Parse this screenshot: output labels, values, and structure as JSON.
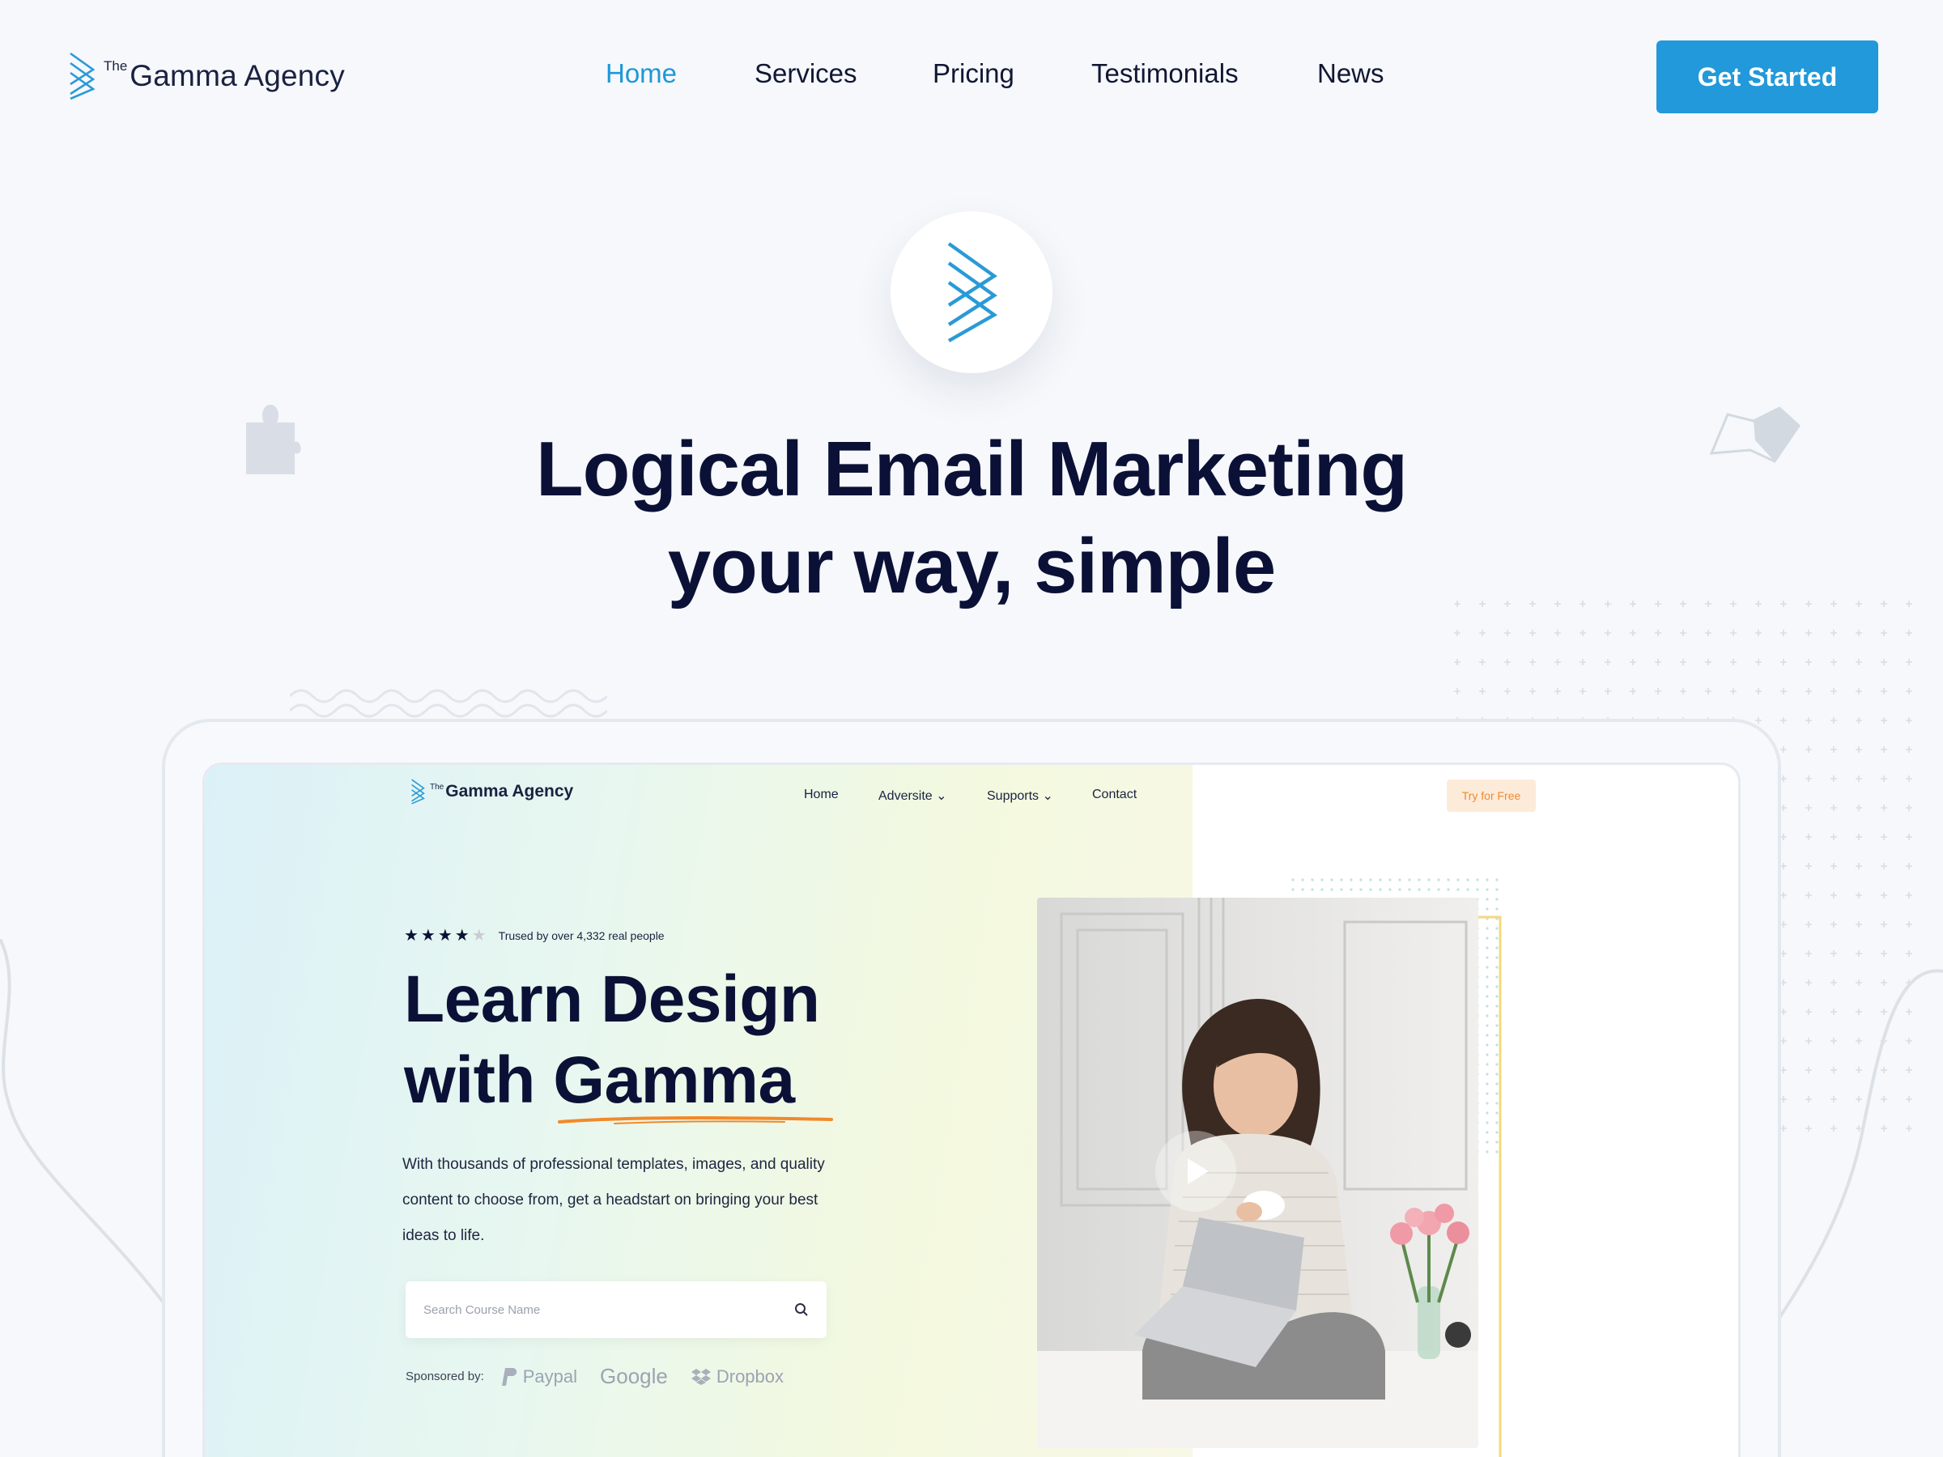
{
  "brand": {
    "prefix": "The",
    "name": "Gamma Agency"
  },
  "nav": {
    "items": [
      {
        "label": "Home",
        "active": true
      },
      {
        "label": "Services",
        "active": false
      },
      {
        "label": "Pricing",
        "active": false
      },
      {
        "label": "Testimonials",
        "active": false
      },
      {
        "label": "News",
        "active": false
      }
    ],
    "cta_label": "Get Started"
  },
  "hero": {
    "title_line1": "Logical Email Marketing",
    "title_line2": "your way, simple"
  },
  "mockup": {
    "brand": {
      "prefix": "The",
      "name": "Gamma Agency"
    },
    "nav": [
      "Home",
      "Adversite ⌄",
      "Supports ⌄",
      "Contact"
    ],
    "cta_label": "Try for Free",
    "rating": {
      "stars": 4,
      "max": 5,
      "trust_text": "Trused by over 4,332 real people"
    },
    "title_line1": "Learn Design",
    "title_line2": "with Gamma",
    "description": "With thousands of professional templates, images, and quality content to choose from, get a headstart on bringing your best ideas to life.",
    "search_placeholder": "Search Course Name",
    "sponsored_label": "Sponsored by:",
    "sponsors": [
      "Paypal",
      "Google",
      "Dropbox"
    ]
  },
  "colors": {
    "accent": "#2199da",
    "navy": "#0b1136",
    "orange": "#f08a2e",
    "background": "#f6f8fb"
  },
  "icons": [
    "gamma-logo-icon",
    "puzzle-icon",
    "handshake-icon",
    "star-icon",
    "search-icon",
    "paypal-icon",
    "dropbox-icon",
    "play-icon"
  ]
}
